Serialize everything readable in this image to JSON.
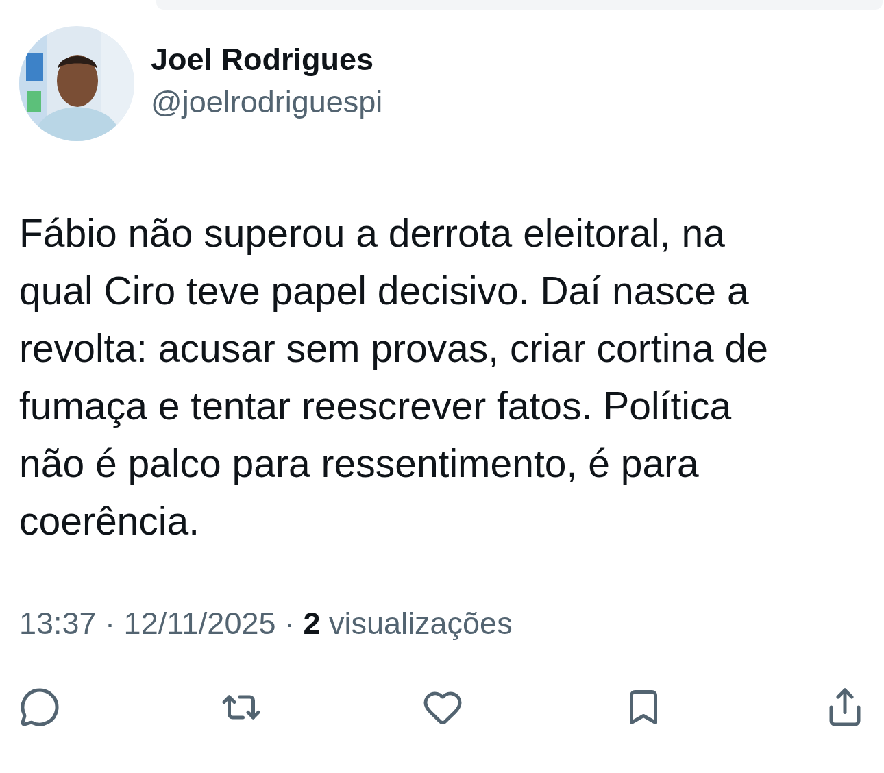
{
  "author": {
    "name": "Joel Rodrigues",
    "handle": "@joelrodriguespi"
  },
  "text": "Fábio não superou a derrota eleitoral, na qual Ciro teve papel decisivo. Daí nasce a revolta: acusar sem provas, criar cortina de fumaça e tentar reescrever fatos. Política não é palco para ressentimento, é para coerência.",
  "meta": "13:37 · 12/11/2025 · **2** visualizações",
  "actions": [
    {
      "kind": "reply"
    },
    {
      "kind": "repost"
    },
    {
      "kind": "like"
    },
    {
      "kind": "bookmark"
    },
    {
      "kind": "share"
    }
  ]
}
